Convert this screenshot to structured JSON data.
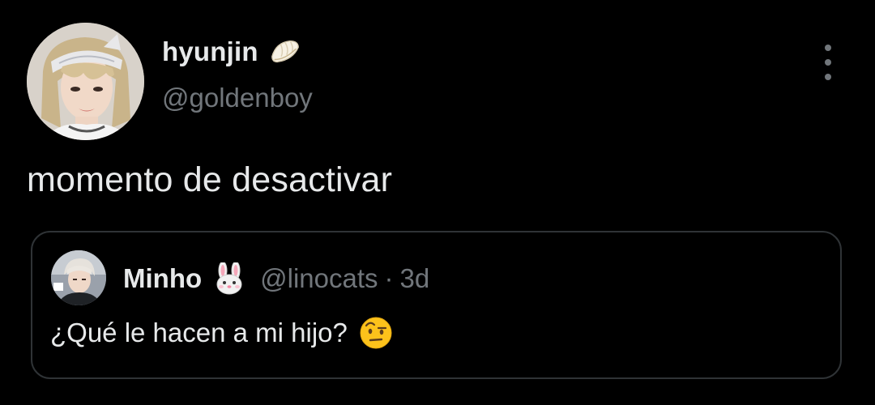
{
  "tweet": {
    "author": {
      "display_name": "hyunjin",
      "name_emoji": "dumpling-emoji",
      "handle": "@goldenboy",
      "avatar": "profile-photo"
    },
    "text": "momento de desactivar",
    "more_icon": "more-options-icon"
  },
  "quoted_tweet": {
    "author": {
      "display_name": "Minho",
      "name_emoji": "rabbit-face-emoji",
      "handle": "@linocats",
      "avatar": "profile-photo"
    },
    "separator": "·",
    "time": "3d",
    "text": "¿Qué le hacen a mi hijo?",
    "text_emoji": "face-with-raised-eyebrow-emoji"
  },
  "colors": {
    "background": "#000000",
    "primary_text": "#e7e9ea",
    "secondary_text": "#71767b",
    "card_border": "#2f3336"
  }
}
